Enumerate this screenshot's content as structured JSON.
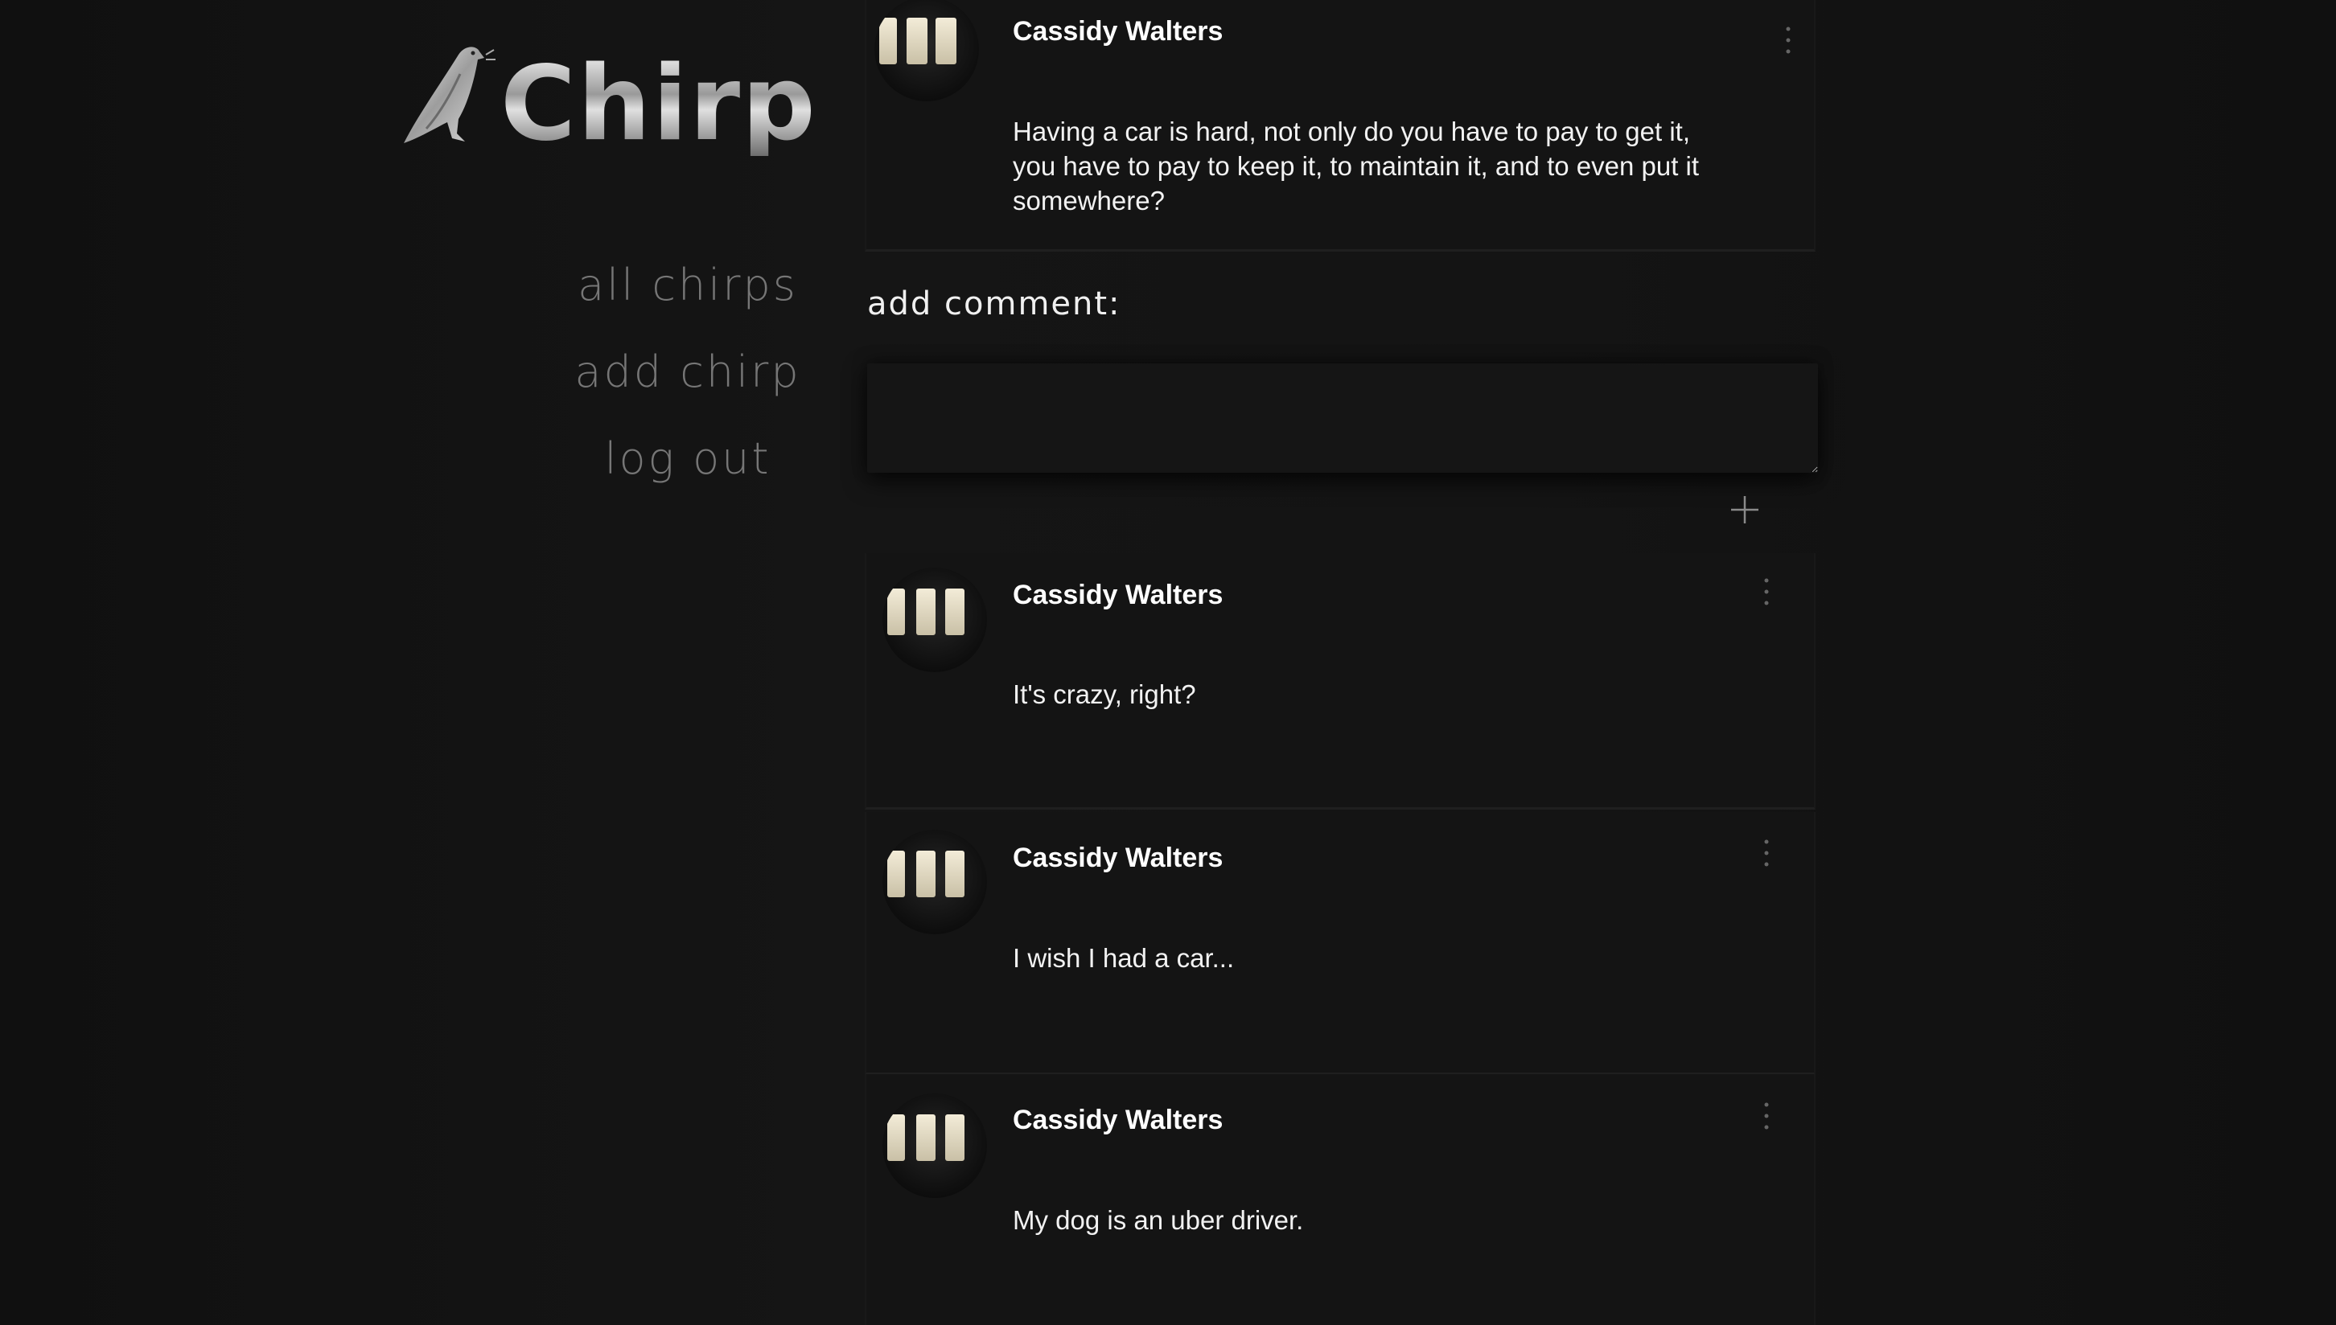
{
  "app": {
    "name": "Chirp"
  },
  "nav": {
    "items": [
      {
        "label": "all chirps"
      },
      {
        "label": "add chirp"
      },
      {
        "label": "log out"
      }
    ]
  },
  "post": {
    "author": "Cassidy Walters",
    "body": "Having a car is hard, not only do you have to pay to get it, you have to pay to keep it, to maintain it, and to even put it somewhere?",
    "menu_icon": "vertical-ellipsis-icon"
  },
  "comment_form": {
    "label": "add comment:",
    "input_value": "",
    "submit_icon": "plus-icon"
  },
  "comments": [
    {
      "author": "Cassidy Walters",
      "body": "It's crazy, right?"
    },
    {
      "author": "Cassidy Walters",
      "body": "I wish I had a car..."
    },
    {
      "author": "Cassidy Walters",
      "body": "My dog is an uber driver."
    }
  ],
  "colors": {
    "background": "#131313",
    "card": "#141414",
    "nav_text": "#767676",
    "text": "#ffffff"
  }
}
